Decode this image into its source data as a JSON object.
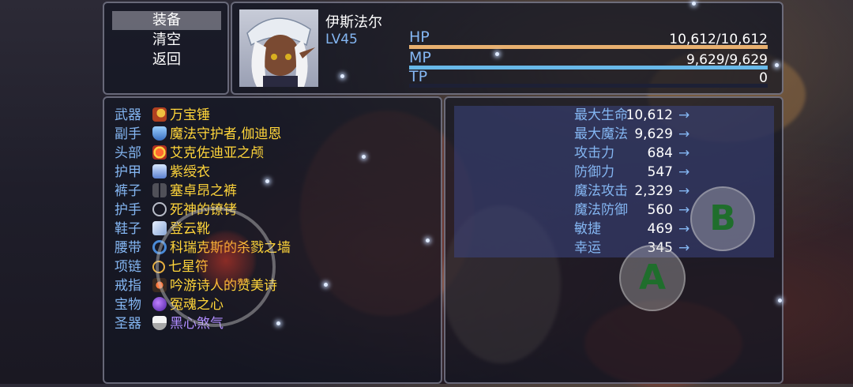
{
  "command_menu": {
    "items": [
      {
        "label": "装备",
        "selected": true
      },
      {
        "label": "清空",
        "selected": false
      },
      {
        "label": "返回",
        "selected": false
      }
    ]
  },
  "actor": {
    "name": "伊斯法尔",
    "level": "LV45",
    "hp": {
      "label": "HP",
      "value": "10,612/10,612",
      "fraction": 1.0,
      "color": "#e8b070"
    },
    "mp": {
      "label": "MP",
      "value": "9,629/9,629",
      "fraction": 1.0,
      "color": "#68b8e8"
    },
    "tp": {
      "label": "TP",
      "value": "0",
      "fraction": 0.0,
      "color": "#60c060"
    }
  },
  "equipment": [
    {
      "slot": "武器",
      "icon": "hammer-icon",
      "item": "万宝锤",
      "color": "#ffd53a"
    },
    {
      "slot": "副手",
      "icon": "shield-icon",
      "item": "魔法守护者,伽迪恩",
      "color": "#ffd53a"
    },
    {
      "slot": "头部",
      "icon": "crown-icon",
      "item": "艾克佐迪亚之颅",
      "color": "#ffd53a"
    },
    {
      "slot": "护甲",
      "icon": "robe-icon",
      "item": "紫绶衣",
      "color": "#ffd53a"
    },
    {
      "slot": "裤子",
      "icon": "pants-icon",
      "item": "塞卓昂之裤",
      "color": "#ffd53a"
    },
    {
      "slot": "护手",
      "icon": "shackle-icon",
      "item": "死神的镣铐",
      "color": "#ffd53a"
    },
    {
      "slot": "鞋子",
      "icon": "boot-icon",
      "item": "登云靴",
      "color": "#ffd53a"
    },
    {
      "slot": "腰带",
      "icon": "belt-icon",
      "item": "科瑞克斯的杀戮之墙",
      "color": "#ffd53a"
    },
    {
      "slot": "项链",
      "icon": "necklace-icon",
      "item": "七星符",
      "color": "#ffd53a"
    },
    {
      "slot": "戒指",
      "icon": "ring-icon",
      "item": "吟游诗人的赞美诗",
      "color": "#ffd53a"
    },
    {
      "slot": "宝物",
      "icon": "orb-icon",
      "item": "冤魂之心",
      "color": "#ffd53a"
    },
    {
      "slot": "圣器",
      "icon": "bowl-icon",
      "item": "黑心煞气",
      "color": "#b08cff"
    }
  ],
  "stats": [
    {
      "name": "最大生命",
      "value": "10,612",
      "arrow": "→"
    },
    {
      "name": "最大魔法",
      "value": "9,629",
      "arrow": "→"
    },
    {
      "name": "攻击力",
      "value": "684",
      "arrow": "→"
    },
    {
      "name": "防御力",
      "value": "547",
      "arrow": "→"
    },
    {
      "name": "魔法攻击",
      "value": "2,329",
      "arrow": "→"
    },
    {
      "name": "魔法防御",
      "value": "560",
      "arrow": "→"
    },
    {
      "name": "敏捷",
      "value": "469",
      "arrow": "→"
    },
    {
      "name": "幸运",
      "value": "345",
      "arrow": "→"
    }
  ],
  "virtual_buttons": {
    "a_label": "A",
    "b_label": "B"
  },
  "colors": {
    "system_blue": "#84b6f2",
    "item_gold": "#ffd53a",
    "button_green": "#1f6e2c"
  }
}
